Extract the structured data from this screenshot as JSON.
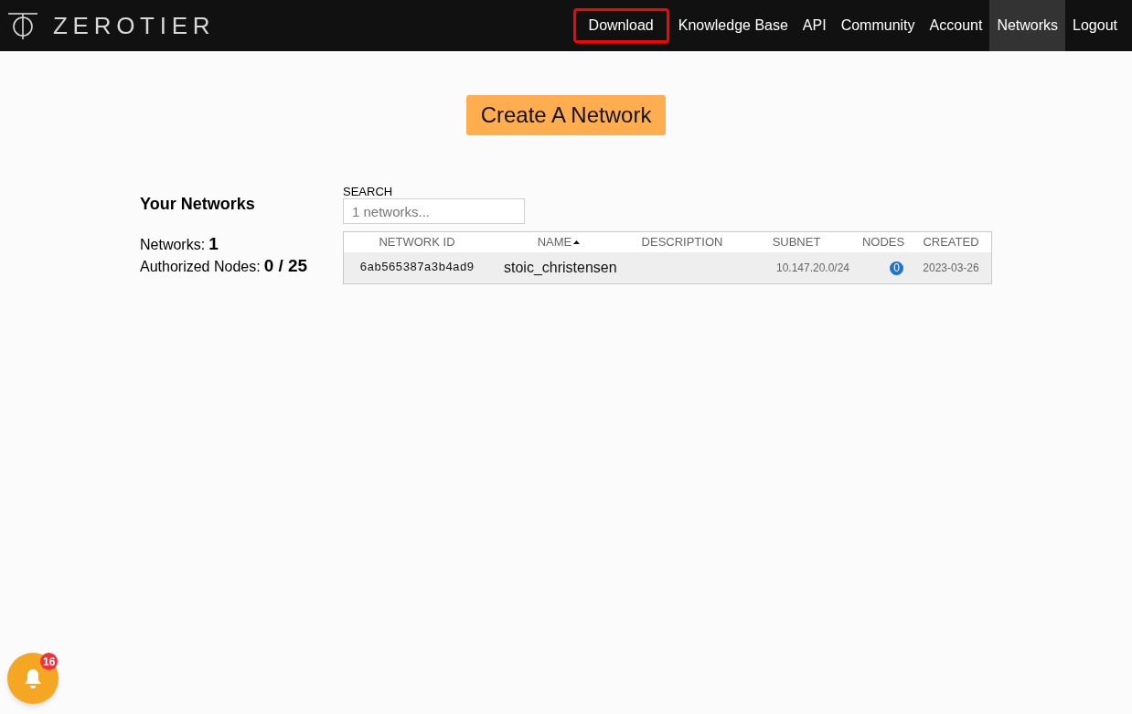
{
  "brand": {
    "name": "ZEROTIER"
  },
  "nav": [
    {
      "label": "Download",
      "selected": false,
      "highlighted": true
    },
    {
      "label": "Knowledge Base",
      "selected": false,
      "highlighted": false
    },
    {
      "label": "API",
      "selected": false,
      "highlighted": false
    },
    {
      "label": "Community",
      "selected": false,
      "highlighted": false
    },
    {
      "label": "Account",
      "selected": false,
      "highlighted": false
    },
    {
      "label": "Networks",
      "selected": true,
      "highlighted": false
    },
    {
      "label": "Logout",
      "selected": false,
      "highlighted": false
    }
  ],
  "create_button": "Create A Network",
  "summary": {
    "title": "Your Networks",
    "stats": [
      {
        "label": "Networks:",
        "value": "1"
      },
      {
        "label": "Authorized Nodes:",
        "value": "0 / 25"
      }
    ]
  },
  "search": {
    "label": "SEARCH",
    "placeholder": "1 networks..."
  },
  "table": {
    "columns": [
      {
        "label": "NETWORK ID",
        "sorted": false
      },
      {
        "label": "NAME",
        "sorted": true
      },
      {
        "label": "DESCRIPTION",
        "sorted": false
      },
      {
        "label": "SUBNET",
        "sorted": false
      },
      {
        "label": "NODES",
        "sorted": false
      },
      {
        "label": "CREATED",
        "sorted": false
      }
    ],
    "rows": [
      {
        "network_id": "6ab565387a3b4ad9",
        "name": "stoic_christensen",
        "subnet": "10.147.20.0/24",
        "nodes": "0",
        "created": "2023-03-26"
      }
    ]
  },
  "notifications": {
    "count": "16"
  }
}
